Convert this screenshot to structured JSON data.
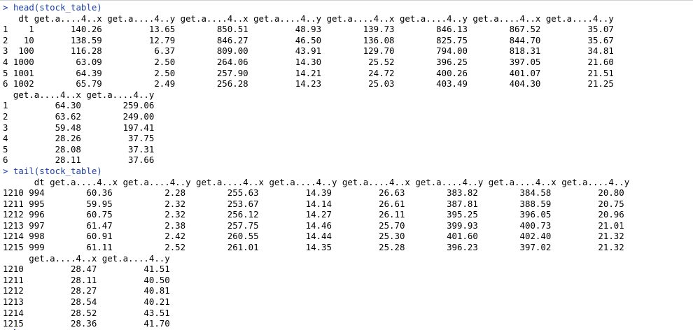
{
  "console": {
    "cmd1": {
      "prompt": ">",
      "text": "head(stock_table)"
    },
    "out1": [
      "   dt get.a....4..x get.a....4..y get.a....4..x get.a....4..y get.a....4..x get.a....4..y get.a....4..x get.a....4..y",
      "1    1       140.26         13.65        850.51         48.93        139.73        846.13        867.52         35.07",
      "2   10       138.59         12.79        846.27         46.50        136.08        825.75        844.70         35.67",
      "3  100       116.28          6.37        809.00         43.91        129.70        794.00        818.31         34.81",
      "4 1000        63.09          2.50        264.06         14.30         25.52        396.25        397.05         21.60",
      "5 1001        64.39          2.50        257.90         14.21         24.72        400.26        401.07         21.51",
      "6 1002        65.79          2.49        256.28         14.23         25.03        403.49        404.30         21.25",
      "  get.a....4..x get.a....4..y",
      "1         64.30        259.06",
      "2         63.62        249.00",
      "3         59.48        197.41",
      "4         28.26         37.75",
      "5         28.08         37.31",
      "6         28.11         37.66"
    ],
    "cmd2": {
      "prompt": ">",
      "text": "tail(stock_table)"
    },
    "out2": [
      "      dt get.a....4..x get.a....4..y get.a....4..x get.a....4..y get.a....4..x get.a....4..y get.a....4..x get.a....4..y",
      "1210 994        60.36          2.28        255.63         14.39         26.63        383.82        384.58         20.80",
      "1211 995        59.95          2.32        253.67         14.14         26.61        387.81        388.59         20.75",
      "1212 996        60.75          2.32        256.12         14.27         26.11        395.25        396.05         20.96",
      "1213 997        61.47          2.38        257.75         14.46         25.70        399.93        400.73         21.01",
      "1214 998        60.91          2.42        260.55         14.44         25.30        401.60        402.40         21.32",
      "1215 999        61.11          2.52        261.01         14.35         25.28        396.23        397.02         21.32",
      "     get.a....4..x get.a....4..y",
      "1210         28.47         41.51",
      "1211         28.11         40.50",
      "1212         28.27         40.81",
      "1213         28.54         40.21",
      "1214         28.52         43.51",
      "1215         28.36         41.70"
    ],
    "input_prompt": ">",
    "input_text": ""
  },
  "colors": {
    "command": "#1c3fa8",
    "output": "#000000",
    "background": "#ffffff"
  }
}
